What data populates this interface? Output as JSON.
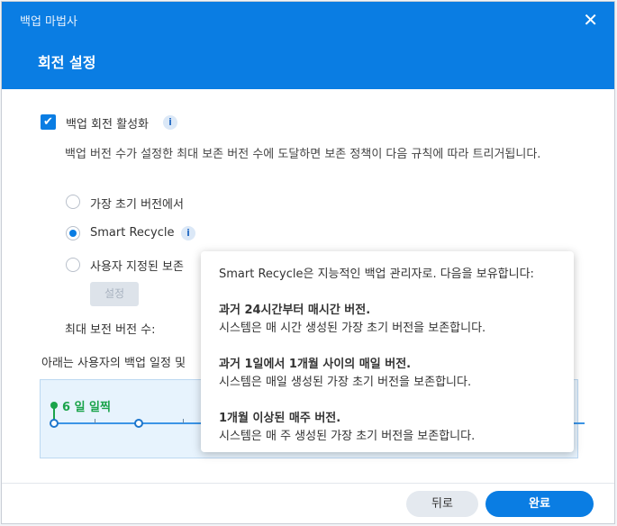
{
  "window": {
    "title": "백업 마법사",
    "close_glyph": "✕"
  },
  "step_title": "회전 설정",
  "rotation": {
    "enable_label": "백업 회전 활성화",
    "enabled": true,
    "info_glyph": "i",
    "description": "백업 버전 수가 설정한 최대 보존 버전 수에 도달하면 보존 정책이 다음 규칙에 따라 트리거됩니다.",
    "options": [
      {
        "label": "가장 초기 버전에서",
        "selected": false
      },
      {
        "label": "Smart Recycle",
        "selected": true
      },
      {
        "label": "사용자 지정된 보존",
        "selected": false
      }
    ],
    "settings_button": "설정",
    "max_versions_label": "최대 보전 버전 수:",
    "schedule_note": "아래는 사용자의 백업 일정 및"
  },
  "timeline": {
    "label": "6 일 일찍"
  },
  "tooltip": {
    "intro": "Smart Recycle은 지능적인 백업 관리자로. 다음을 보유합니다:",
    "rules": [
      {
        "title": "과거 24시간부터 매시간 버전.",
        "detail": "시스템은 매 시간 생성된 가장 초기 버전을 보존합니다."
      },
      {
        "title": "과거 1일에서 1개월 사이의 매일 버전.",
        "detail": "시스템은 매일 생성된 가장 초기 버전을 보존합니다."
      },
      {
        "title": "1개월 이상된 매주 버전.",
        "detail": "시스템은 매 주 생성된 가장 초기 버전을 보존합니다."
      }
    ]
  },
  "footer": {
    "back_label": "뒤로",
    "done_label": "완료"
  },
  "colors": {
    "accent": "#0a7de3",
    "timeline_marker": "#1aa34a"
  }
}
